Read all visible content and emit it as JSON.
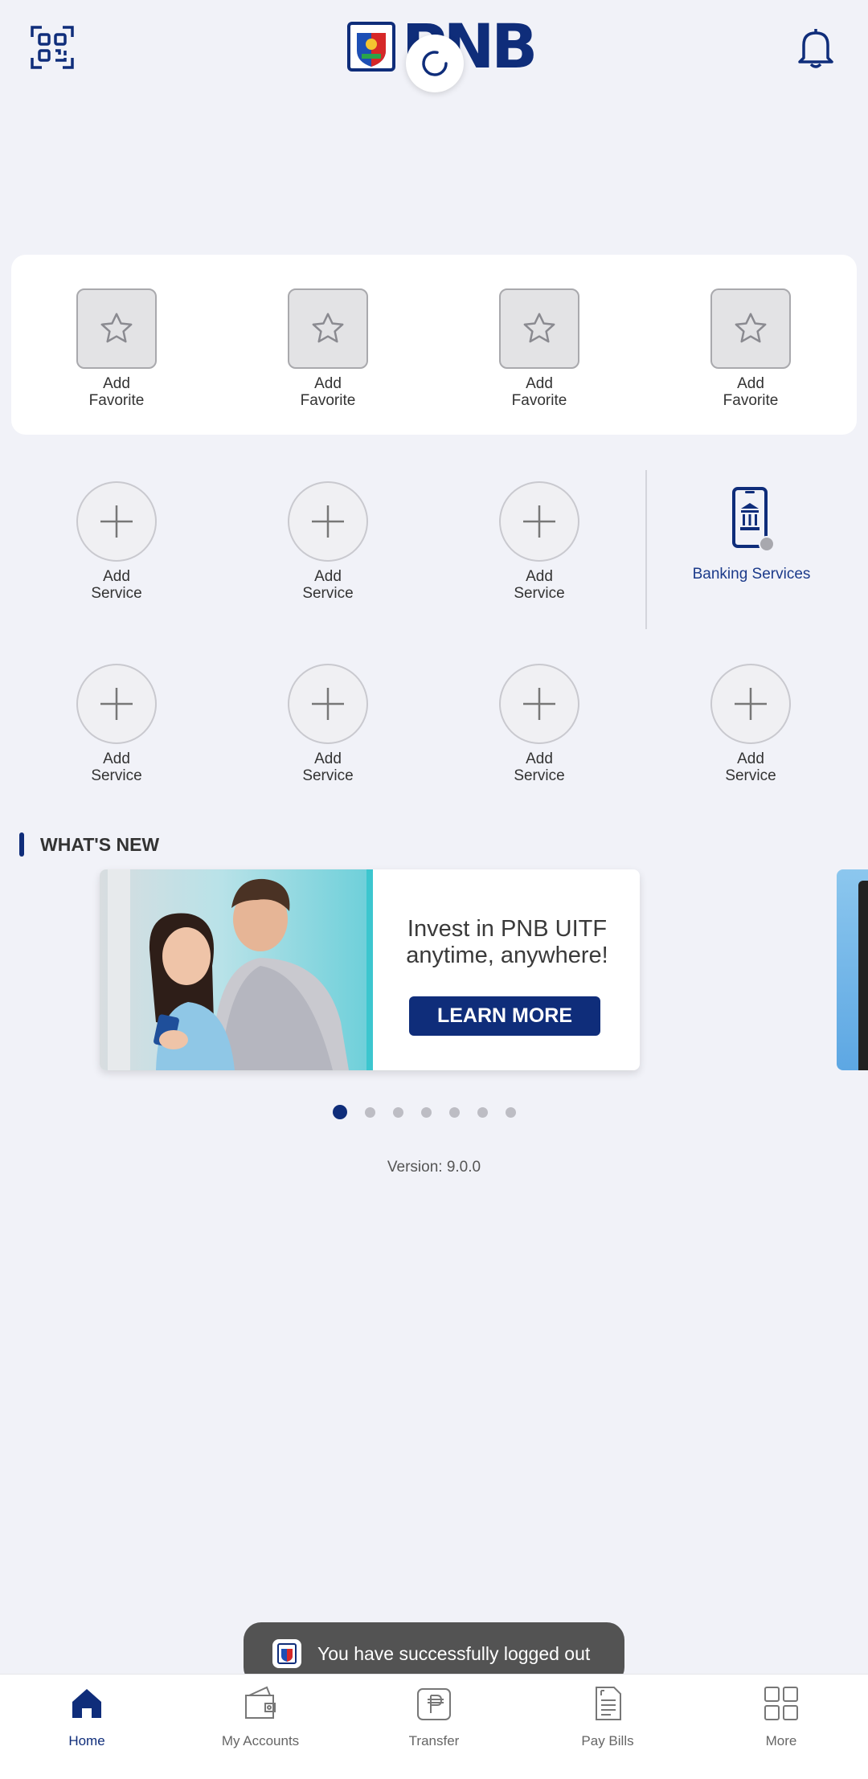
{
  "header": {
    "logo_text": "PNB",
    "qr_icon": "qr-scan-icon",
    "bell_icon": "bell-icon"
  },
  "favorites": [
    {
      "line1": "Add",
      "line2": "Favorite"
    },
    {
      "line1": "Add",
      "line2": "Favorite"
    },
    {
      "line1": "Add",
      "line2": "Favorite"
    },
    {
      "line1": "Add",
      "line2": "Favorite"
    }
  ],
  "services_row1": [
    {
      "line1": "Add",
      "line2": "Service"
    },
    {
      "line1": "Add",
      "line2": "Service"
    },
    {
      "line1": "Add",
      "line2": "Service"
    }
  ],
  "banking_services": {
    "label": "Banking Services",
    "icon": "mobile-bank-icon"
  },
  "services_row2": [
    {
      "line1": "Add",
      "line2": "Service"
    },
    {
      "line1": "Add",
      "line2": "Service"
    },
    {
      "line1": "Add",
      "line2": "Service"
    },
    {
      "line1": "Add",
      "line2": "Service"
    }
  ],
  "whats_new": {
    "title": "WHAT'S NEW",
    "banner": {
      "headline_line1": "Invest in PNB UITF",
      "headline_line2": "anytime, anywhere!",
      "button": "LEARN MORE"
    },
    "dots_total": 7,
    "active_dot": 1
  },
  "version": "Version: 9.0.0",
  "toast": {
    "message": "You have successfully logged out"
  },
  "bottom_nav": [
    {
      "label": "Home",
      "icon": "home-icon",
      "active": true
    },
    {
      "label": "My Accounts",
      "icon": "wallet-icon",
      "active": false
    },
    {
      "label": "Transfer",
      "icon": "transfer-icon",
      "active": false
    },
    {
      "label": "Pay Bills",
      "icon": "bill-icon",
      "active": false
    },
    {
      "label": "More",
      "icon": "grid-icon",
      "active": false
    }
  ],
  "colors": {
    "brand": "#0f2d7a",
    "background": "#f1f2f8",
    "accent": "#3cc6cf"
  }
}
